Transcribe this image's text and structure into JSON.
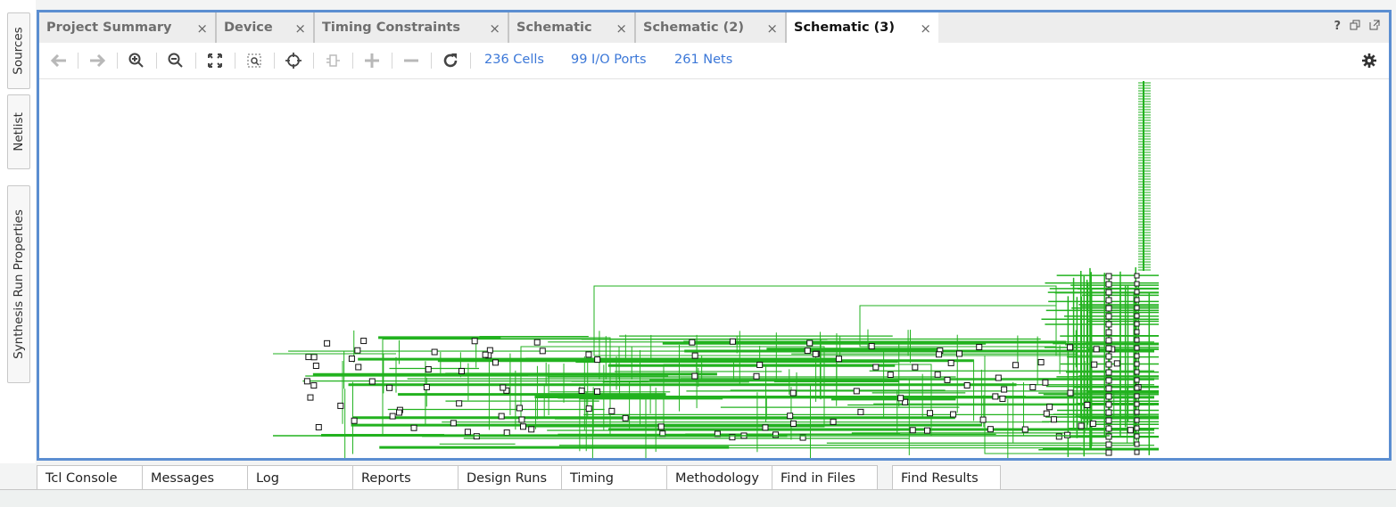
{
  "left_tabs": [
    "Sources",
    "Netlist",
    "Synthesis Run Properties"
  ],
  "tabs": [
    {
      "label": "Project Summary",
      "close": "×"
    },
    {
      "label": "Device",
      "close": "×"
    },
    {
      "label": "Timing Constraints",
      "close": "×"
    },
    {
      "label": "Schematic",
      "close": "×"
    },
    {
      "label": "Schematic (2)",
      "close": "×"
    },
    {
      "label": "Schematic (3)",
      "close": "×",
      "active": true
    }
  ],
  "window_controls": {
    "help": "?",
    "restore": "restore-icon",
    "float": "float-icon"
  },
  "toolbar": {
    "icons": [
      "back-arrow-icon",
      "forward-arrow-icon",
      "zoom-in-icon",
      "zoom-out-icon",
      "zoom-fit-icon",
      "zoom-area-icon",
      "select-crosshair-icon",
      "cell-icon",
      "expand-plus-icon",
      "collapse-minus-icon",
      "refresh-icon"
    ],
    "cells": "236 Cells",
    "io_ports": "99 I/O Ports",
    "nets": "261 Nets",
    "settings_icon": "gear-icon"
  },
  "colors": {
    "accent_border": "#5b8ed1",
    "net_green": "#22b21f",
    "stat_blue": "#3c78d8"
  },
  "bottom_tabs": [
    "Tcl Console",
    "Messages",
    "Log",
    "Reports",
    "Design Runs",
    "Timing",
    "Methodology",
    "Find in Files",
    "Find Results"
  ]
}
